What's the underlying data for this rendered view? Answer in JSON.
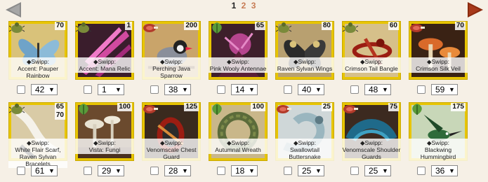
{
  "pagination": {
    "current": "1",
    "pages": [
      "2",
      "3"
    ]
  },
  "colors": {
    "tile": "#e8c500",
    "page_link": "#c77b54",
    "prev_arrow": "#888888",
    "next_arrow": "#8b2b0e"
  },
  "items": [
    {
      "qty": "70",
      "label_1": "◆Swipp:",
      "label_2": "Accent: Pauper Rainbow",
      "select": "42",
      "art": "butterfly-blue",
      "seller": "bug-icon"
    },
    {
      "qty": "1",
      "label_1": "◆Swipp:",
      "label_2": "Accent: Mana Relic",
      "select": "1",
      "art": "pink-streaks",
      "seller": "bug-icon"
    },
    {
      "qty": "200",
      "label_1": "◆Swipp:",
      "label_2": "Perching Java Sparrow",
      "select": "38",
      "art": "sparrow",
      "seller": "meat-icon"
    },
    {
      "qty": "65",
      "label_1": "◆Swipp:",
      "label_2": "Pink Wooly Antennae",
      "select": "14",
      "art": "wooly-antennae",
      "seller": "leaf-icon"
    },
    {
      "qty": "80",
      "label_1": "◆Swipp:",
      "label_2": "Raven Sylvan Wings",
      "select": "40",
      "art": "dark-wings",
      "seller": "bug-icon"
    },
    {
      "qty": "60",
      "label_1": "◆Swipp:",
      "label_2": "Crimson Tail Bangle",
      "select": "48",
      "art": "crimson-bangle",
      "seller": "bug-icon"
    },
    {
      "qty": "70",
      "label_1": "◆Swipp:",
      "label_2": "Crimson Silk Veil",
      "select": "59",
      "art": "mushrooms-orange",
      "seller": "meat-icon"
    },
    {
      "qty": "65",
      "qty_2": "70",
      "label_1": "◆Swipp:",
      "label_2": "White Flair Scarf, Raven Sylvan Bracelets",
      "select": "61",
      "art": "white-scarf",
      "seller": "bug-icon"
    },
    {
      "qty": "100",
      "label_1": "◆Swipp:",
      "label_2": "Vista: Fungi",
      "select": "29",
      "art": "fungi",
      "seller": "leaf-icon"
    },
    {
      "qty": "125",
      "label_1": "◆Swipp:",
      "label_2": "Venomscale Chest Guard",
      "select": "28",
      "art": "chest-guard",
      "seller": "meat-icon"
    },
    {
      "qty": "100",
      "label_1": "◆Swipp:",
      "label_2": "Autumnal Wreath",
      "select": "18",
      "art": "wreath",
      "seller": "leaf-icon"
    },
    {
      "qty": "25",
      "label_1": "◆Swipp:",
      "label_2": "Swallowtail Buttersnake",
      "select": "25",
      "art": "buttersnake",
      "seller": "meat-icon"
    },
    {
      "qty": "75",
      "label_1": "◆Swipp:",
      "label_2": "Venomscale Shoulder Guards",
      "select": "25",
      "art": "shoulder-guards",
      "seller": "meat-icon"
    },
    {
      "qty": "175",
      "label_1": "◆Swipp:",
      "label_2": "Blackwing Hummingbird",
      "select": "36",
      "art": "hummingbird",
      "seller": "leaf-icon"
    }
  ]
}
